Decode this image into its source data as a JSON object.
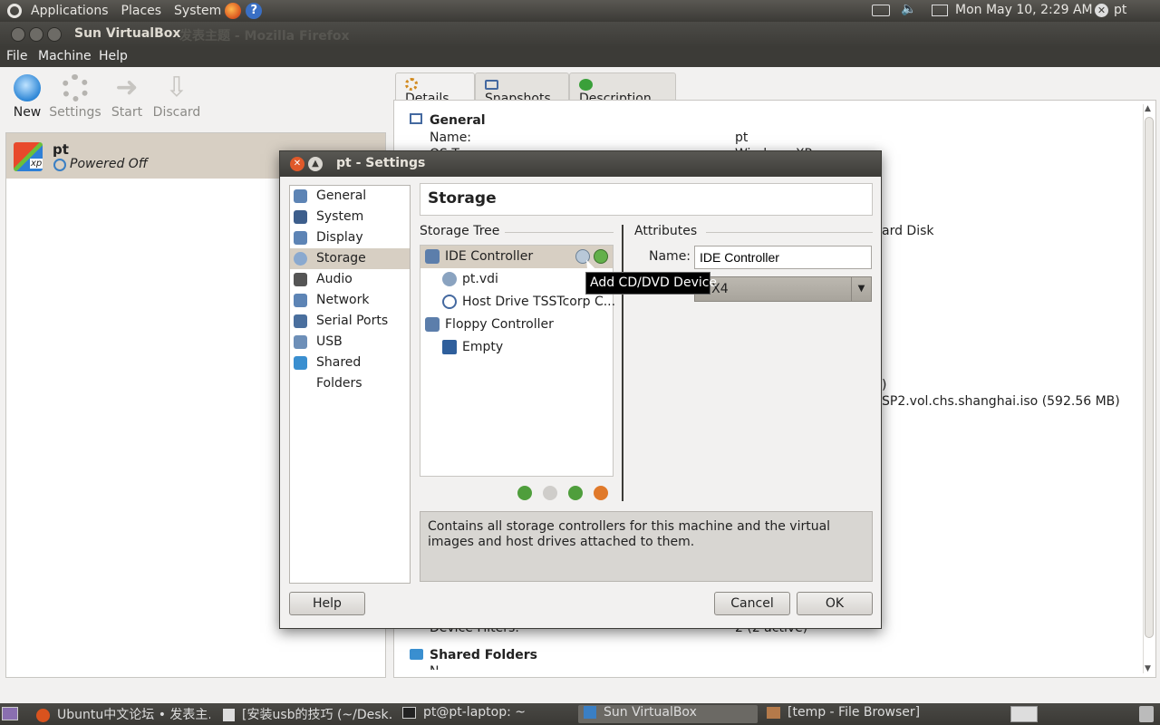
{
  "top_panel": {
    "menus": [
      "Applications",
      "Places",
      "System"
    ],
    "datetime": "Mon May 10,  2:29 AM",
    "user": "pt"
  },
  "window": {
    "title": "Sun VirtualBox",
    "title_behind": "发表主题 - Mozilla Firefox",
    "menus": [
      "File",
      "Machine",
      "Help"
    ]
  },
  "toolbar": {
    "new": "New",
    "settings": "Settings",
    "start": "Start",
    "discard": "Discard"
  },
  "vm": {
    "name": "pt",
    "state": "Powered Off",
    "os_badge": "xp"
  },
  "tabs": {
    "details": "Details",
    "snapshots": "Snapshots",
    "description": "Description"
  },
  "details": {
    "general_title": "General",
    "name_label": "Name:",
    "name_value": "pt",
    "os_label": "OS T...",
    "os_value": "Windows XP",
    "frag_hdd": "ard Disk",
    "frag_paren": ")",
    "frag_iso": "SP2.vol.chs.shanghai.iso (592.56 MB)",
    "usb_filters_label": "Device Filters:",
    "usb_filters_value": "2 (2 active)",
    "shared_title": "Shared Folders",
    "shared_value": "N..."
  },
  "dialog": {
    "title": "pt - Settings",
    "categories": [
      "General",
      "System",
      "Display",
      "Storage",
      "Audio",
      "Network",
      "Serial Ports",
      "USB",
      "Shared Folders"
    ],
    "page_title": "Storage",
    "storage_tree_label": "Storage Tree",
    "attributes_label": "Attributes",
    "tree": {
      "ide": "IDE Controller",
      "vdi": "pt.vdi",
      "host": "Host Drive TSSTcorp C...",
      "floppy": "Floppy Controller",
      "empty": "Empty"
    },
    "attr_name_label": "Name:",
    "attr_name_value": "IDE Controller",
    "attr_type_label": "Ty",
    "attr_type_value": "IX4",
    "tooltip": "Add CD/DVD Device",
    "description": "Contains all storage controllers for this machine and the virtual images and host drives attached to them.",
    "help": "Help",
    "cancel": "Cancel",
    "ok": "OK"
  },
  "taskbar": {
    "items": [
      "Ubuntu中文论坛 • 发表主…",
      "[安装usb的技巧 (~/Desk…",
      "pt@pt-laptop: ~",
      "Sun VirtualBox",
      "[temp - File Browser]"
    ]
  },
  "colors": {
    "selection": "#d7cfc3",
    "panel_dark": "#3c3b37",
    "accent_close": "#e0592a"
  }
}
